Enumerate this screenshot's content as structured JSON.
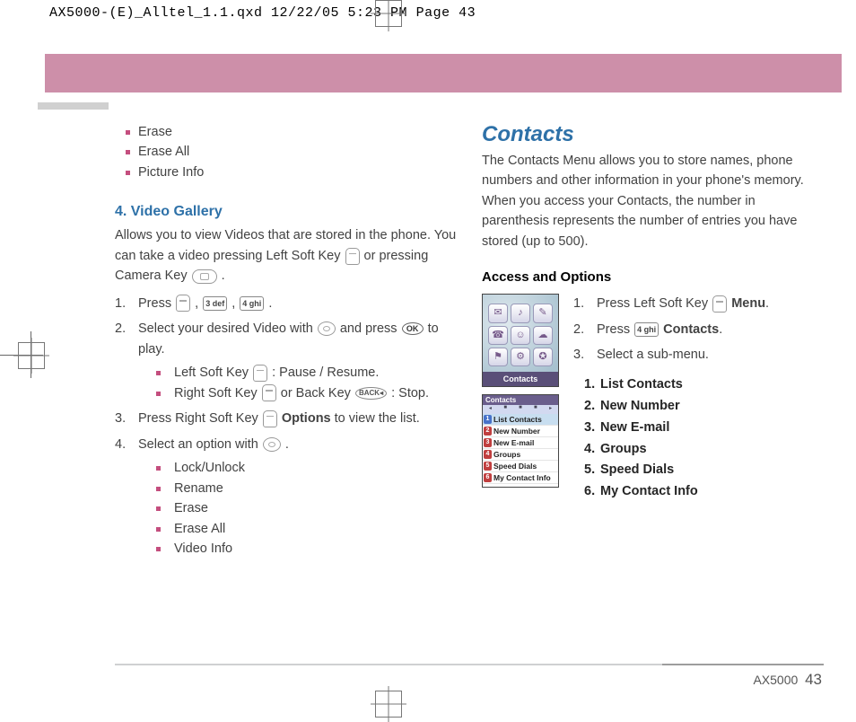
{
  "slug": "AX5000-(E)_Alltel_1.1.qxd  12/22/05  5:23 PM  Page 43",
  "footer": {
    "model": "AX5000",
    "page": "43"
  },
  "left": {
    "bullets_top": [
      "Erase",
      "Erase All",
      "Picture Info"
    ],
    "heading": "4. Video Gallery",
    "intro_a": "Allows you to view Videos that are stored in the phone. You can take a video pressing Left Soft Key ",
    "intro_b": " or pressing Camera Key ",
    "intro_c": " .",
    "step1_a": "Press ",
    "step1_b": " , ",
    "step1_c": " , ",
    "step1_d": " .",
    "key3": "3 def",
    "key4": "4 ghi",
    "step2_a": "Select your desired Video with ",
    "step2_b": " and press ",
    "step2_c": " to play.",
    "ok": "OK",
    "step2_sub": [
      {
        "pre": "Left Soft Key ",
        "post": ": Pause / Resume."
      },
      {
        "pre": "Right Soft Key ",
        "mid": " or Back Key ",
        "post": " : Stop."
      }
    ],
    "back": "BACK◂",
    "step3_a": "Press Right Soft Key ",
    "step3_b": " Options",
    "step3_c": " to view the list.",
    "step4_a": "Select an option with ",
    "step4_b": " .",
    "step4_sub": [
      "Lock/Unlock",
      "Rename",
      "Erase",
      "Erase All",
      "Video Info"
    ]
  },
  "right": {
    "title": "Contacts",
    "intro": "The Contacts Menu allows you to store names, phone numbers and other information in your phone's memory. When you access your Contacts, the number in parenthesis represents the number of entries you have stored (up to 500).",
    "sub": "Access and Options",
    "shot1_bar": "Contacts",
    "shot2_hdr": "Contacts",
    "shot2_rows": [
      {
        "n": "1",
        "c": "#4772c9",
        "t": "List Contacts"
      },
      {
        "n": "2",
        "c": "#c03f3f",
        "t": "New Number"
      },
      {
        "n": "3",
        "c": "#c03f3f",
        "t": "New E-mail"
      },
      {
        "n": "4",
        "c": "#c03f3f",
        "t": "Groups"
      },
      {
        "n": "5",
        "c": "#c03f3f",
        "t": "Speed Dials"
      },
      {
        "n": "6",
        "c": "#c03f3f",
        "t": "My Contact Info"
      }
    ],
    "step1_a": "Press Left Soft Key ",
    "step1_b": " Menu",
    "step1_c": ".",
    "step2_a": "Press ",
    "key4": "4 ghi",
    "step2_b": " Contacts",
    "step2_c": ".",
    "step3": "Select a sub-menu.",
    "submenu": [
      "List Contacts",
      "New Number",
      "New E-mail",
      "Groups",
      "Speed Dials",
      "My Contact Info"
    ]
  }
}
